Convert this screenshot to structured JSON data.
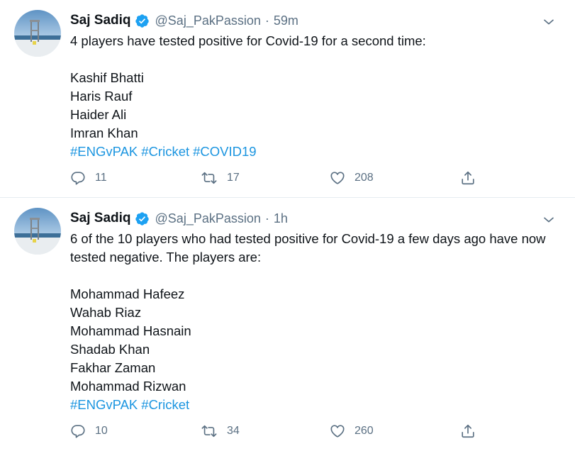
{
  "tweets": [
    {
      "author": "Saj Sadiq",
      "handle": "@Saj_PakPassion",
      "separator": "·",
      "time": "59m",
      "lines": [
        "4 players have tested positive for Covid-19 for a second time:",
        "",
        "Kashif Bhatti",
        "Haris Rauf",
        "Haider Ali",
        "Imran Khan"
      ],
      "hashtags": [
        "#ENGvPAK",
        "#Cricket",
        "#COVID19"
      ],
      "replies": "11",
      "retweets": "17",
      "likes": "208"
    },
    {
      "author": "Saj Sadiq",
      "handle": "@Saj_PakPassion",
      "separator": "·",
      "time": "1h",
      "lines": [
        "6 of the 10 players who had tested positive for Covid-19 a few days ago have now tested negative. The players are:",
        "",
        "Mohammad Hafeez",
        "Wahab Riaz",
        "Mohammad Hasnain",
        "Shadab Khan",
        "Fakhar Zaman",
        "Mohammad Rizwan"
      ],
      "hashtags": [
        "#ENGvPAK",
        "#Cricket"
      ],
      "replies": "10",
      "retweets": "34",
      "likes": "260"
    }
  ],
  "icons": {
    "verified": "verified-badge-icon",
    "caret": "chevron-down-icon",
    "reply": "reply-icon",
    "retweet": "retweet-icon",
    "like": "heart-icon",
    "share": "share-icon"
  },
  "colors": {
    "name": "#0f1419",
    "muted": "#5b7083",
    "link": "#1b95e0",
    "verified": "#1da1f2",
    "divider": "#e6ecf0"
  }
}
